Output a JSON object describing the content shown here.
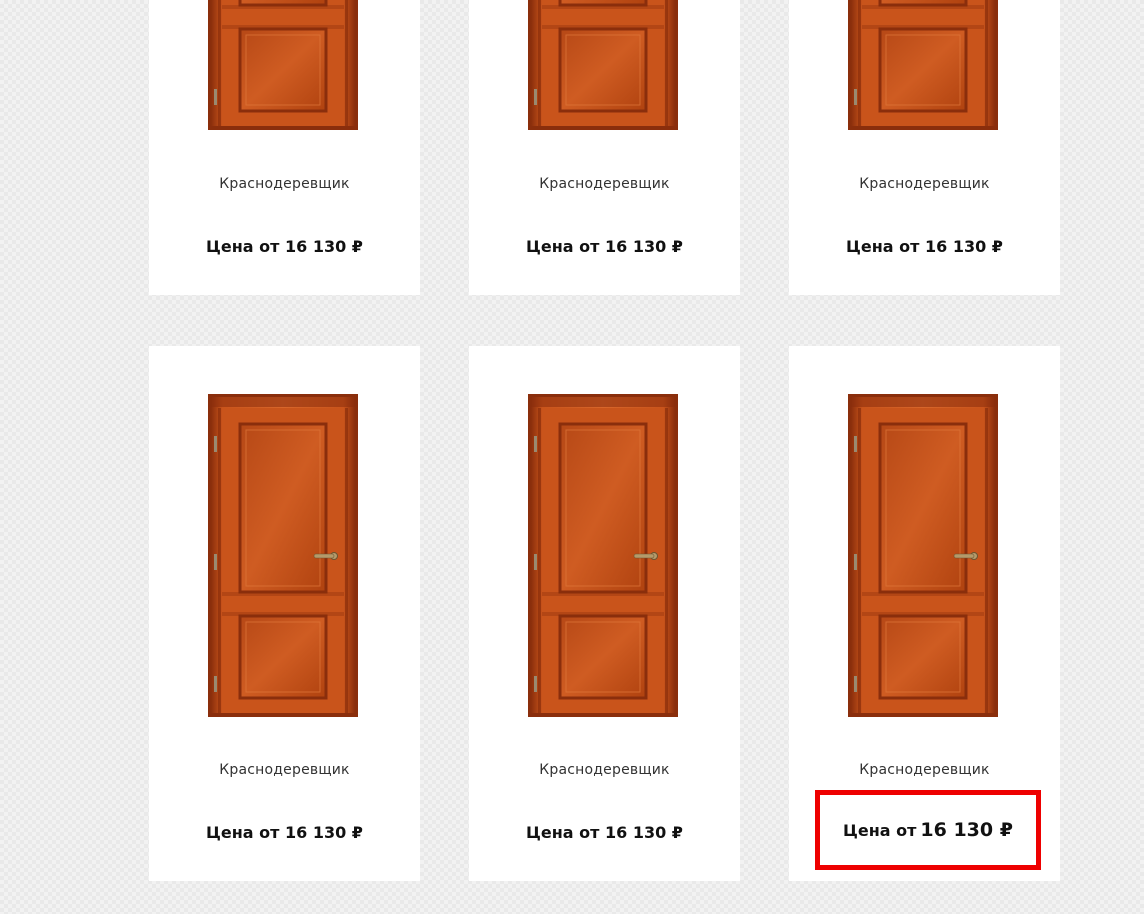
{
  "products": [
    {
      "name": "Краснодеревщик",
      "price": "Цена от 16 130 ₽"
    },
    {
      "name": "Краснодеревщик",
      "price": "Цена от 16 130 ₽"
    },
    {
      "name": "Краснодеревщик",
      "price": "Цена от 16 130 ₽"
    },
    {
      "name": "Краснодеревщик",
      "price": "Цена от 16 130 ₽"
    },
    {
      "name": "Краснодеревщик",
      "price": "Цена от 16 130 ₽"
    },
    {
      "name": "Краснодеревщик",
      "price": "Цена от 16 130 ₽"
    }
  ],
  "highlight": {
    "prefix": "Цена от",
    "amount": "16 130 ₽",
    "border_color": "#ee0000"
  },
  "colors": {
    "door_wood": "#c9541b",
    "door_dark": "#8a2e0c",
    "handle": "#b49a6a"
  }
}
